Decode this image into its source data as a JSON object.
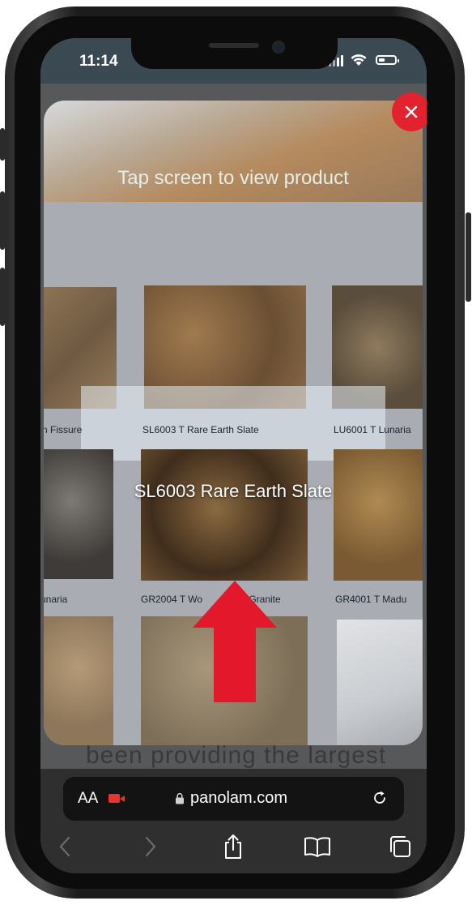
{
  "status_bar": {
    "time": "11:14"
  },
  "ar_view": {
    "hint": "Tap screen to view product",
    "detected_product": "SL6003 Rare Earth Slate",
    "swatch_captions": [
      "n Fissure",
      "SL6003 T  Rare Earth Slate",
      "LU6001 T  Lunaria",
      "unaria",
      "GR2004 T  Wo",
      "k Granite",
      "GR4001 T  Madu"
    ]
  },
  "page_behind": {
    "text": "been providing the largest"
  },
  "safari": {
    "aa_label": "AA",
    "url": "panolam.com"
  },
  "colors": {
    "close": "#e2222e",
    "arrow": "#e3192b",
    "accent_camera": "#e8332f"
  }
}
